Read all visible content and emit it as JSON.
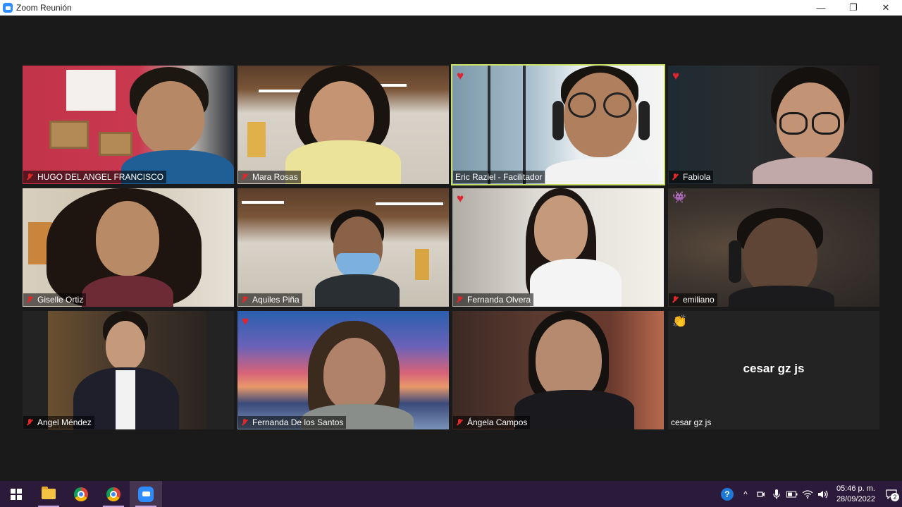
{
  "window": {
    "title": "Zoom Reunión",
    "minimize_glyph": "—",
    "restore_glyph": "❐",
    "close_glyph": "✕"
  },
  "participants": [
    {
      "name": "HUGO DEL ANGEL FRANCISCO",
      "muted": true,
      "reaction": null,
      "active_speaker": false
    },
    {
      "name": "Mara Rosas",
      "muted": true,
      "reaction": null,
      "active_speaker": false
    },
    {
      "name": "Eric Raziel - Facilitador",
      "muted": false,
      "reaction": "heart",
      "active_speaker": true
    },
    {
      "name": "Fabiola",
      "muted": true,
      "reaction": "heart",
      "active_speaker": false
    },
    {
      "name": "Giselle Ortiz",
      "muted": true,
      "reaction": null,
      "active_speaker": false
    },
    {
      "name": "Aquiles Piña",
      "muted": true,
      "reaction": null,
      "active_speaker": false
    },
    {
      "name": "Fernanda Olvera",
      "muted": true,
      "reaction": "heart",
      "active_speaker": false
    },
    {
      "name": "emiliano",
      "muted": true,
      "reaction": "alien",
      "active_speaker": false
    },
    {
      "name": "Angel Méndez",
      "muted": true,
      "reaction": null,
      "active_speaker": false
    },
    {
      "name": "Fernanda De los Santos",
      "muted": true,
      "reaction": "heart",
      "active_speaker": false
    },
    {
      "name": "Ángela Campos",
      "muted": true,
      "reaction": null,
      "active_speaker": false
    },
    {
      "name": "cesar gz js",
      "muted": false,
      "reaction": "clap",
      "active_speaker": false,
      "video_off": true,
      "center_label": "cesar gz js"
    }
  ],
  "reaction_glyphs": {
    "heart": "♥",
    "alien": "👾",
    "clap": "👏"
  },
  "taskbar": {
    "apps": [
      "start-icon",
      "file-explorer-icon",
      "chrome-icon",
      "chrome-profile-icon",
      "zoom-icon"
    ],
    "clock_time": "05:46 p. m.",
    "clock_date": "28/09/2022",
    "notification_count": "2",
    "help_glyph": "?",
    "chevron_glyph": "^"
  },
  "colors": {
    "active_speaker_border": "#c8e06b",
    "mute_red": "#e02828",
    "heart_red": "#e0242f",
    "taskbar_bg": "#2c1a3a",
    "zoom_blue": "#2d8cff"
  }
}
